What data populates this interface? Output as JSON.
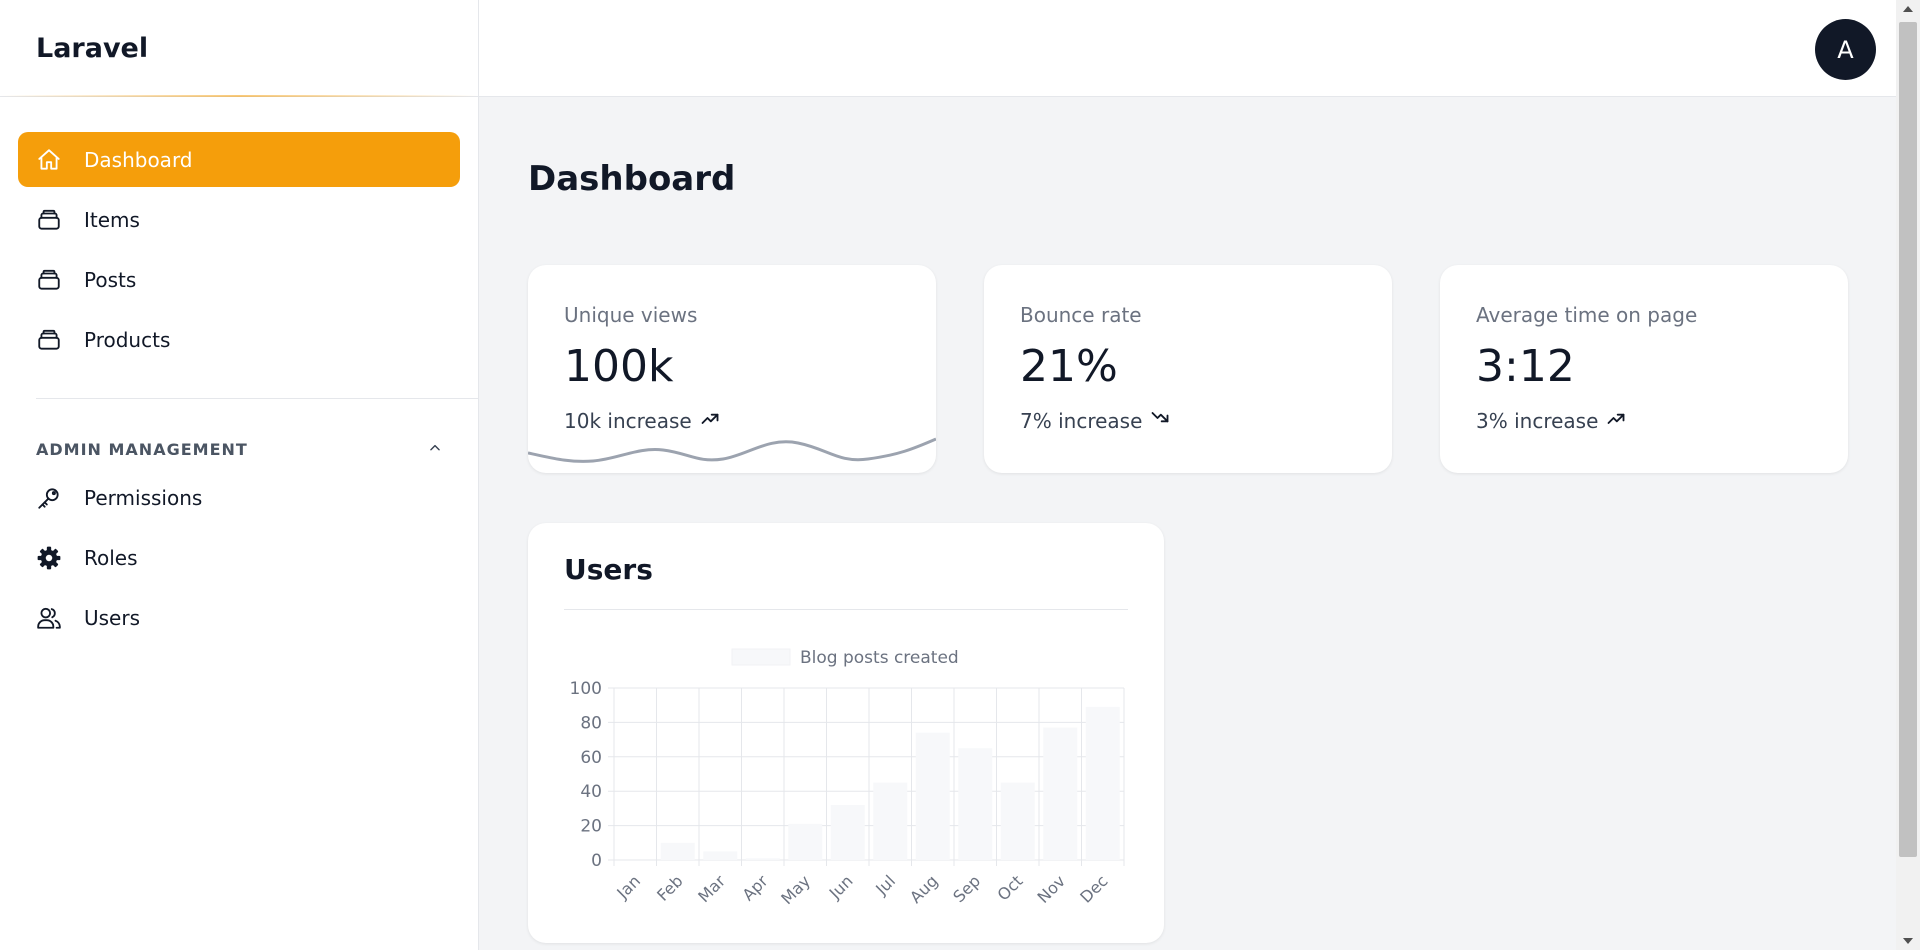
{
  "app": {
    "brand": "Laravel"
  },
  "sidebar": {
    "items": [
      {
        "label": "Dashboard",
        "icon": "home-icon",
        "active": true
      },
      {
        "label": "Items",
        "icon": "stack-icon",
        "active": false
      },
      {
        "label": "Posts",
        "icon": "stack-icon",
        "active": false
      },
      {
        "label": "Products",
        "icon": "stack-icon",
        "active": false
      }
    ],
    "section": {
      "label": "ADMIN MANAGEMENT",
      "expanded": true,
      "items": [
        {
          "label": "Permissions",
          "icon": "key-icon"
        },
        {
          "label": "Roles",
          "icon": "gear-icon"
        },
        {
          "label": "Users",
          "icon": "users-icon"
        }
      ]
    }
  },
  "header": {
    "avatar_initial": "A"
  },
  "main": {
    "title": "Dashboard",
    "stats": [
      {
        "label": "Unique views",
        "value": "100k",
        "change": "10k increase",
        "trend": "up"
      },
      {
        "label": "Bounce rate",
        "value": "21%",
        "change": "7% increase",
        "trend": "down"
      },
      {
        "label": "Average time on page",
        "value": "3:12",
        "change": "3% increase",
        "trend": "up"
      }
    ],
    "users_card": {
      "title": "Users"
    }
  },
  "colors": {
    "accent": "#f59e0b",
    "text": "#111827",
    "muted": "#6b7280",
    "background": "#f3f4f6",
    "bar": "#f7f8fa",
    "sparkline": "#9ca3af"
  },
  "chart_data": {
    "type": "bar",
    "legend": [
      "Blog posts created"
    ],
    "legend_position": "top",
    "categories": [
      "Jan",
      "Feb",
      "Mar",
      "Apr",
      "May",
      "Jun",
      "Jul",
      "Aug",
      "Sep",
      "Oct",
      "Nov",
      "Dec"
    ],
    "series": [
      {
        "name": "Blog posts created",
        "values": [
          0,
          10,
          5,
          1,
          21,
          32,
          45,
          74,
          65,
          45,
          77,
          89
        ]
      }
    ],
    "ylim": [
      0,
      100
    ],
    "yticks": [
      0,
      20,
      40,
      60,
      80,
      100
    ],
    "grid": true
  }
}
